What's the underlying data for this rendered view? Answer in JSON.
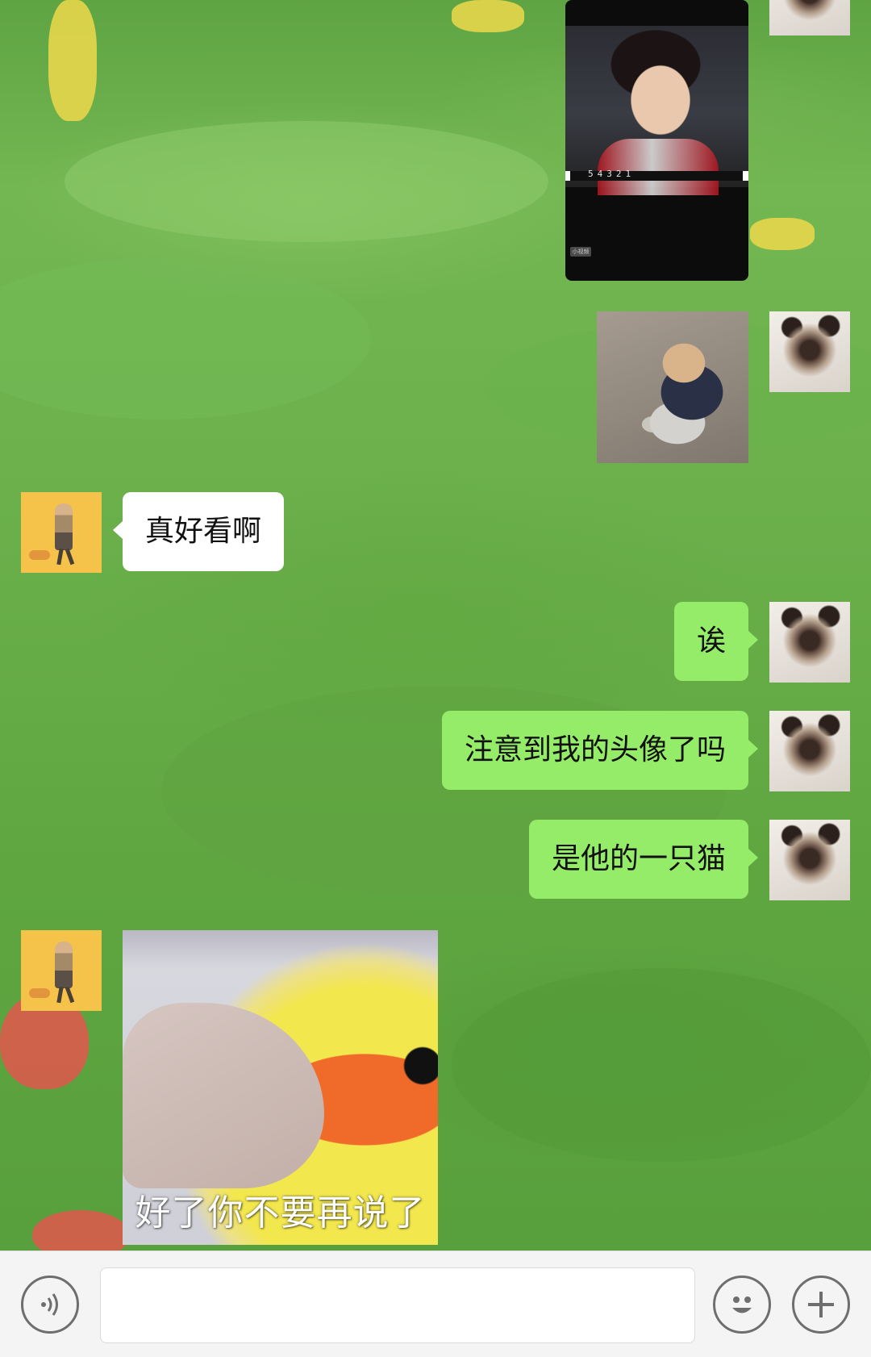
{
  "chat": {
    "messages": [
      {
        "sender": "me",
        "type": "video-image",
        "countdown": "54321",
        "label": "小视频"
      },
      {
        "sender": "me",
        "type": "image"
      },
      {
        "sender": "friend",
        "type": "text",
        "text": "真好看啊"
      },
      {
        "sender": "me",
        "type": "text",
        "text": "诶"
      },
      {
        "sender": "me",
        "type": "text",
        "text": "注意到我的头像了吗"
      },
      {
        "sender": "me",
        "type": "text",
        "text": "是他的一只猫"
      },
      {
        "sender": "friend",
        "type": "image",
        "caption": "好了你不要再说了"
      }
    ]
  },
  "input_bar": {
    "voice_icon": "voice-icon",
    "emoji_icon": "emoji-icon",
    "plus_icon": "plus-icon",
    "text_value": ""
  },
  "colors": {
    "outgoing_bubble": "#95ec69",
    "incoming_bubble": "#ffffff",
    "wallpaper": "#64ad45"
  }
}
